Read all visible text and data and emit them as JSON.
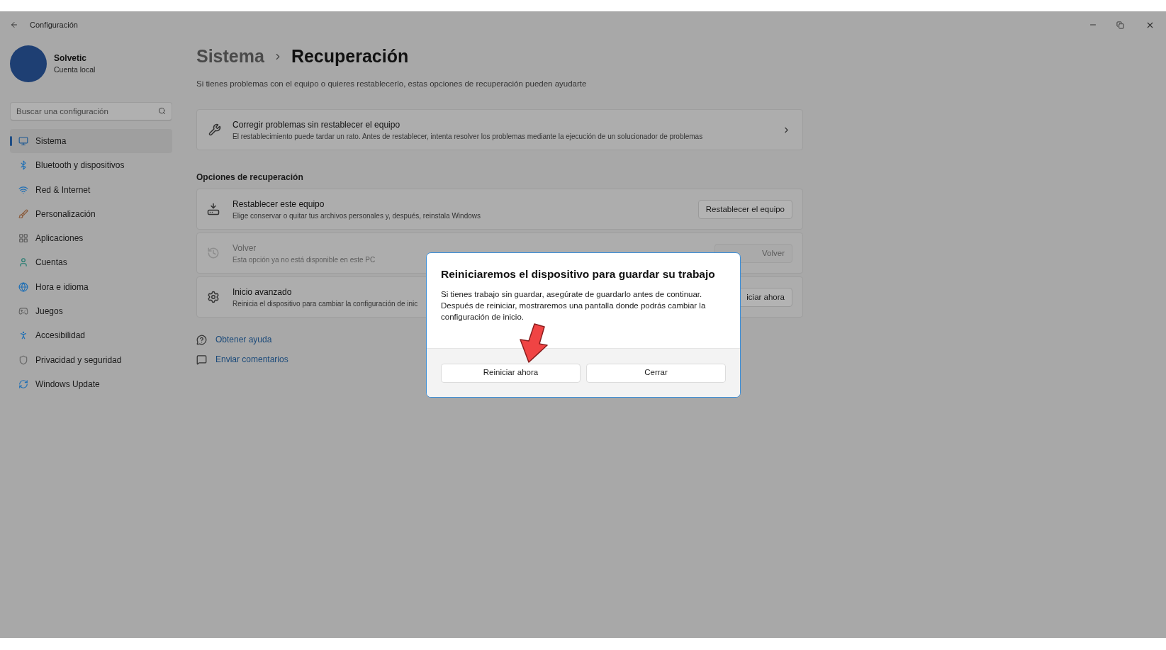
{
  "window": {
    "title": "Configuración"
  },
  "account": {
    "name": "Solvetic",
    "type": "Cuenta local"
  },
  "search": {
    "placeholder": "Buscar una configuración"
  },
  "nav": [
    {
      "label": "Sistema",
      "selected": true
    },
    {
      "label": "Bluetooth y dispositivos",
      "selected": false
    },
    {
      "label": "Red & Internet",
      "selected": false
    },
    {
      "label": "Personalización",
      "selected": false
    },
    {
      "label": "Aplicaciones",
      "selected": false
    },
    {
      "label": "Cuentas",
      "selected": false
    },
    {
      "label": "Hora e idioma",
      "selected": false
    },
    {
      "label": "Juegos",
      "selected": false
    },
    {
      "label": "Accesibilidad",
      "selected": false
    },
    {
      "label": "Privacidad y seguridad",
      "selected": false
    },
    {
      "label": "Windows Update",
      "selected": false
    }
  ],
  "breadcrumb": {
    "parent": "Sistema",
    "current": "Recuperación"
  },
  "description": "Si tienes problemas con el equipo o quieres restablecerlo, estas opciones de recuperación pueden ayudarte",
  "fix_card": {
    "title": "Corregir problemas sin restablecer el equipo",
    "subtitle": "El restablecimiento puede tardar un rato. Antes de restablecer, intenta resolver los problemas mediante la ejecución de un solucionador de problemas"
  },
  "section_title": "Opciones de recuperación",
  "options": [
    {
      "title": "Restablecer este equipo",
      "subtitle": "Elige conservar o quitar tus archivos personales y, después, reinstala Windows",
      "button": "Restablecer el equipo",
      "disabled": false
    },
    {
      "title": "Volver",
      "subtitle": "Esta opción ya no está disponible en este PC",
      "button": "Volver",
      "disabled": true
    },
    {
      "title": "Inicio avanzado",
      "subtitle": "Reinicia el dispositivo para cambiar la configuración de inic",
      "button": "iciar ahora",
      "disabled": false
    }
  ],
  "links": [
    "Obtener ayuda",
    "Enviar comentarios"
  ],
  "dialog": {
    "title": "Reiniciaremos el dispositivo para guardar su trabajo",
    "body": "Si tienes trabajo sin guardar, asegúrate de guardarlo antes de continuar. Después de reiniciar, mostraremos una pantalla donde podrás cambiar la configuración de inicio.",
    "buttons": [
      "Reiniciar ahora",
      "Cerrar"
    ]
  }
}
